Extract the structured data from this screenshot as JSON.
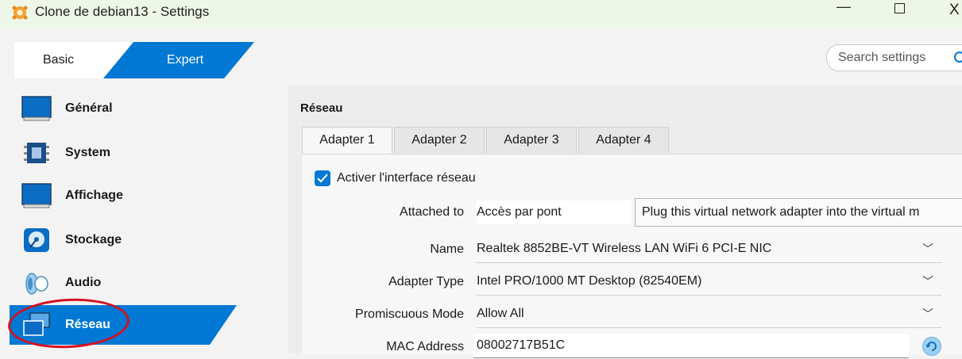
{
  "window": {
    "title": "Clone de debian13 - Settings",
    "minimize": "—",
    "close": "X"
  },
  "mode": {
    "basic": "Basic",
    "expert": "Expert"
  },
  "search": {
    "placeholder": "Search settings"
  },
  "sidebar": {
    "items": [
      {
        "label": "Général",
        "icon": "monitor-icon"
      },
      {
        "label": "System",
        "icon": "chip-icon"
      },
      {
        "label": "Affichage",
        "icon": "display-icon"
      },
      {
        "label": "Stockage",
        "icon": "disk-icon"
      },
      {
        "label": "Audio",
        "icon": "speaker-icon"
      },
      {
        "label": "Réseau",
        "icon": "network-icon",
        "active": true
      }
    ]
  },
  "main": {
    "section_title": "Réseau",
    "tabs": [
      "Adapter 1",
      "Adapter 2",
      "Adapter 3",
      "Adapter 4"
    ],
    "active_tab": "Adapter 1",
    "enable_label": "Activer l'interface réseau",
    "enable_checked": true,
    "attached_to": {
      "label": "Attached to",
      "value": "Accès par pont"
    },
    "tooltip": "Plug this virtual network adapter into the virtual m",
    "name": {
      "label": "Name",
      "value": "Realtek 8852BE-VT Wireless LAN WiFi 6 PCI-E NIC"
    },
    "adapter_type": {
      "label": "Adapter Type",
      "value": "Intel PRO/1000 MT Desktop (82540EM)"
    },
    "promiscuous": {
      "label": "Promiscuous Mode",
      "value": "Allow All"
    },
    "mac": {
      "label": "MAC Address",
      "value": "08002717B51C"
    }
  },
  "colors": {
    "accent": "#0078d4",
    "annotation": "#d5111e"
  }
}
